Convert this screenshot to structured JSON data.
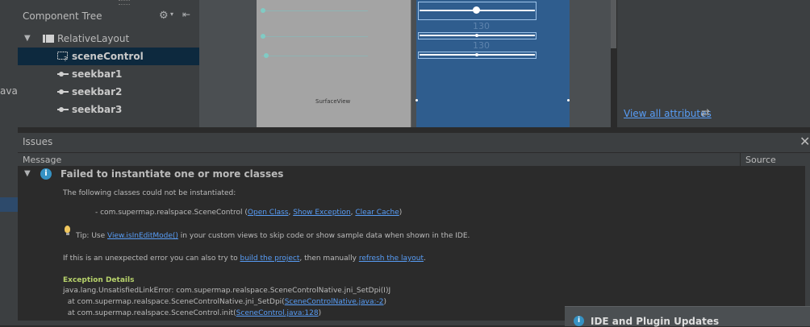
{
  "left_strip": {
    "text": "ava"
  },
  "component_tree": {
    "title": "Component Tree",
    "icons": {
      "settings": "gear-icon",
      "dropdown": "chevron-down-icon",
      "collapse": "collapse-icon"
    },
    "items": [
      {
        "label": "RelativeLayout",
        "icon": "layout-icon",
        "expanded": true
      },
      {
        "label": "sceneControl",
        "icon": "unknown-view-icon",
        "selected": true
      },
      {
        "label": "seekbar1",
        "icon": "seekbar-icon"
      },
      {
        "label": "seekbar2",
        "icon": "seekbar-icon"
      },
      {
        "label": "seekbar3",
        "icon": "seekbar-icon"
      }
    ]
  },
  "design_preview": {
    "surface_label": "SurfaceView",
    "seekbar_levels": [
      0.0,
      0.0,
      0.02
    ]
  },
  "blueprint": {
    "ghost_texts": [
      "130",
      "130"
    ],
    "seekbar_levels": [
      0.5,
      0.5,
      0.5
    ]
  },
  "attributes": {
    "view_all_label": "View all attributes",
    "swap_icon": "swap-arrows-icon"
  },
  "issues": {
    "title": "Issues",
    "close_icon": "close-icon",
    "columns": {
      "message": "Message",
      "source": "Source"
    },
    "issue": {
      "title": "Failed to instantiate one or more classes",
      "icon": "info-icon",
      "line1": "The following classes could not be instantiated:",
      "class_line": {
        "prefix": "- com.supermap.realspace.SceneControl (",
        "open_class": "Open Class",
        "sep1": ", ",
        "show_exception": "Show Exception",
        "sep2": ", ",
        "clear_cache": "Clear Cache",
        "suffix": ")"
      },
      "tip": {
        "prefix": "Tip: Use ",
        "link": "View.isInEditMode()",
        "suffix": " in your custom views to skip code or show sample data when shown in the IDE."
      },
      "unexpected": {
        "prefix": "If this is an unexpected error you can also try to ",
        "link1": "build the project",
        "middle": ", then manually ",
        "link2": "refresh the layout",
        "suffix": "."
      },
      "exception_title": "Exception Details",
      "stack": [
        {
          "text": "java.lang.UnsatisfiedLinkError: com.supermap.realspace.SceneControlNative.jni_SetDpi(I)J"
        },
        {
          "prefix": "  at com.supermap.realspace.SceneControlNative.jni_SetDpi(",
          "link": "SceneControlNative.java:-2",
          "suffix": ")"
        },
        {
          "prefix": "  at com.supermap.realspace.SceneControl.init(",
          "link": "SceneControl.java:128",
          "suffix": ")"
        }
      ]
    }
  },
  "notification": {
    "title": "IDE and Plugin Updates",
    "icon": "info-icon"
  }
}
